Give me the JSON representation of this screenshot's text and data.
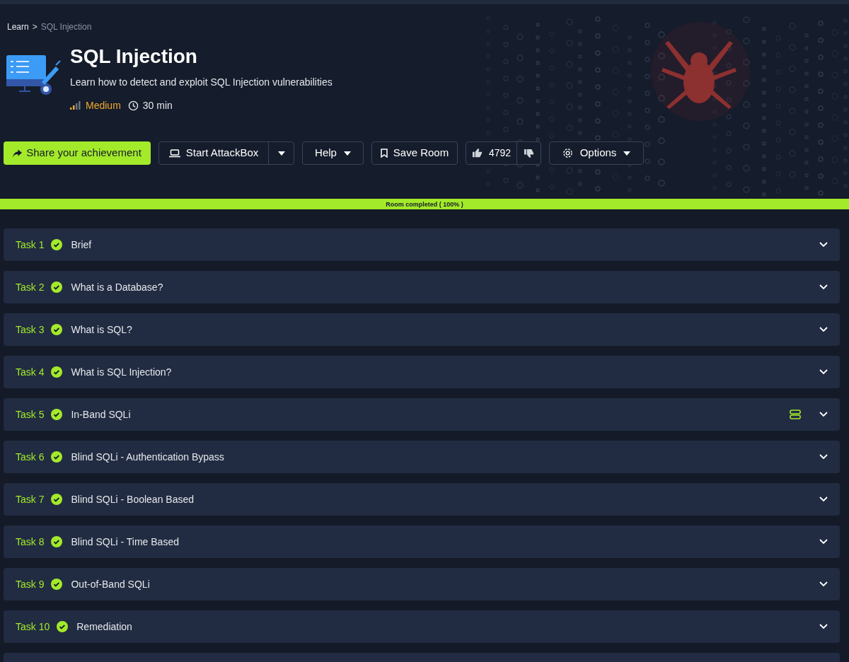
{
  "breadcrumb": {
    "items": [
      {
        "label": "Learn",
        "selected": false
      },
      {
        "label": "SQL Injection",
        "selected": true
      }
    ],
    "separator": ">"
  },
  "room": {
    "title": "SQL Injection",
    "description": "Learn how to detect and exploit SQL Injection vulnerabilities",
    "difficulty": "Medium",
    "difficulty_meter": {
      "level": 0.5
    },
    "duration": "30 min"
  },
  "actions": {
    "share": "Share your achievement",
    "attackbox": "Start AttackBox",
    "help": "Help",
    "save": "Save Room",
    "likes": "4792",
    "options": "Options"
  },
  "progress": {
    "label": "Room completed ( 100% )",
    "level": 1
  },
  "tasks": [
    {
      "number": "Task 1",
      "title": "Brief",
      "completed": true,
      "expanded": false,
      "has_server": false
    },
    {
      "number": "Task 2",
      "title": "What is a Database?",
      "completed": true,
      "expanded": false,
      "has_server": false
    },
    {
      "number": "Task 3",
      "title": "What is SQL?",
      "completed": true,
      "expanded": false,
      "has_server": false
    },
    {
      "number": "Task 4",
      "title": "What is SQL Injection?",
      "completed": true,
      "expanded": false,
      "has_server": false
    },
    {
      "number": "Task 5",
      "title": "In-Band SQLi",
      "completed": true,
      "expanded": false,
      "has_server": true
    },
    {
      "number": "Task 6",
      "title": "Blind SQLi - Authentication Bypass",
      "completed": true,
      "expanded": false,
      "has_server": false
    },
    {
      "number": "Task 7",
      "title": "Blind SQLi - Boolean Based",
      "completed": true,
      "expanded": false,
      "has_server": false
    },
    {
      "number": "Task 8",
      "title": "Blind SQLi - Time Based",
      "completed": true,
      "expanded": false,
      "has_server": false
    },
    {
      "number": "Task 9",
      "title": "Out-of-Band SQLi",
      "completed": true,
      "expanded": false,
      "has_server": false
    },
    {
      "number": "Task 10",
      "title": "Remediation",
      "completed": true,
      "expanded": false,
      "has_server": false
    }
  ]
}
